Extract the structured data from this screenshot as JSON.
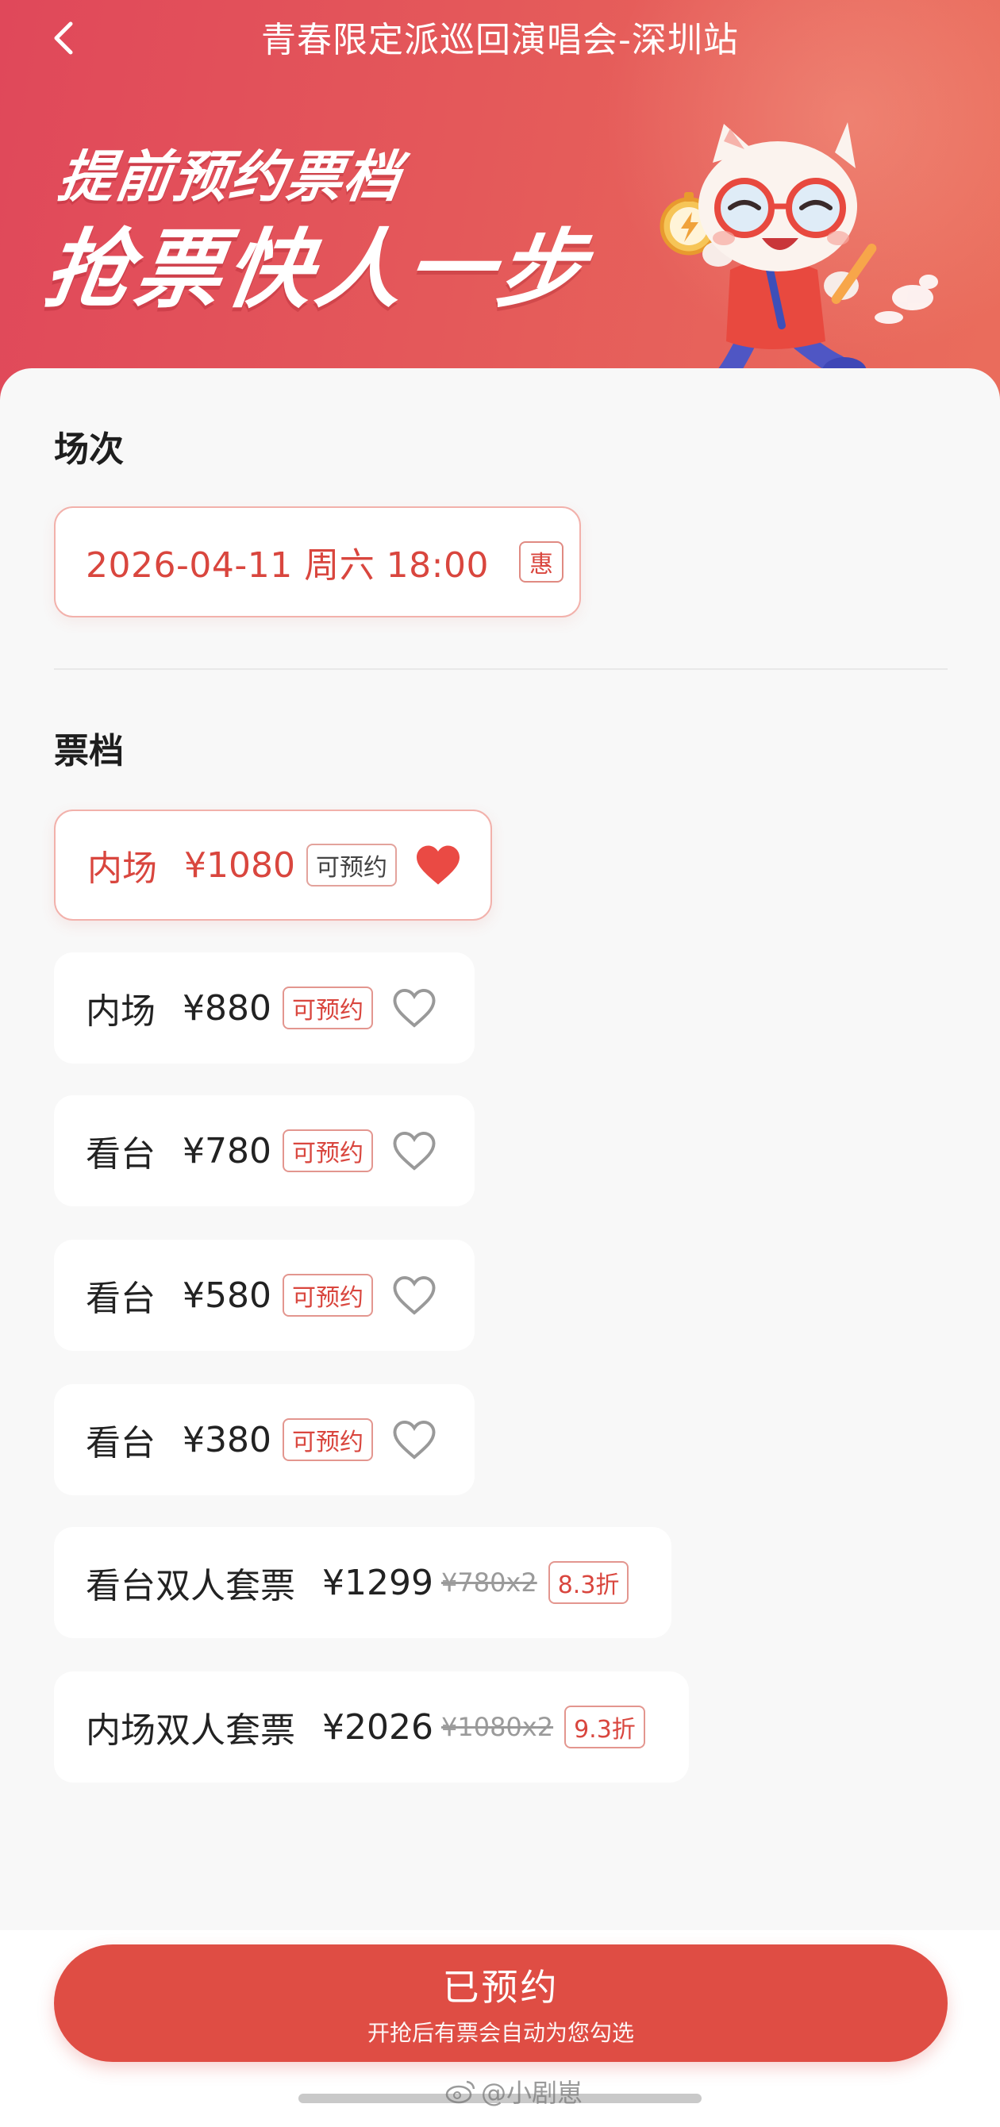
{
  "nav": {
    "title": "青春限定派巡回演唱会-深圳站"
  },
  "banner": {
    "slogan_line1": "提前预约票档",
    "slogan_line2": "抢票快人一步"
  },
  "session": {
    "section_title": "场次",
    "selected": "2026-04-11 周六 18:00",
    "badge": "惠"
  },
  "tiers": {
    "section_title": "票档",
    "items": [
      {
        "label": "内场",
        "price": "¥1080",
        "tag": "可预约",
        "selected": true
      },
      {
        "label": "内场",
        "price": "¥880",
        "tag": "可预约",
        "selected": false
      },
      {
        "label": "看台",
        "price": "¥780",
        "tag": "可预约",
        "selected": false
      },
      {
        "label": "看台",
        "price": "¥580",
        "tag": "可预约",
        "selected": false
      },
      {
        "label": "看台",
        "price": "¥380",
        "tag": "可预约",
        "selected": false
      }
    ],
    "bundles": [
      {
        "label": "看台双人套票",
        "price": "¥1299",
        "original": "¥780x2",
        "discount": "8.3折"
      },
      {
        "label": "内场双人套票",
        "price": "¥2026",
        "original": "¥1080x2",
        "discount": "9.3折"
      }
    ]
  },
  "cta": {
    "title": "已预约",
    "subtitle": "开抢后有票会自动为您勾选"
  },
  "watermark": {
    "text": "@小剧崽"
  },
  "colors": {
    "accent": "#df4d44",
    "banner_start": "#e0485a",
    "banner_end": "#ea6d5c"
  }
}
